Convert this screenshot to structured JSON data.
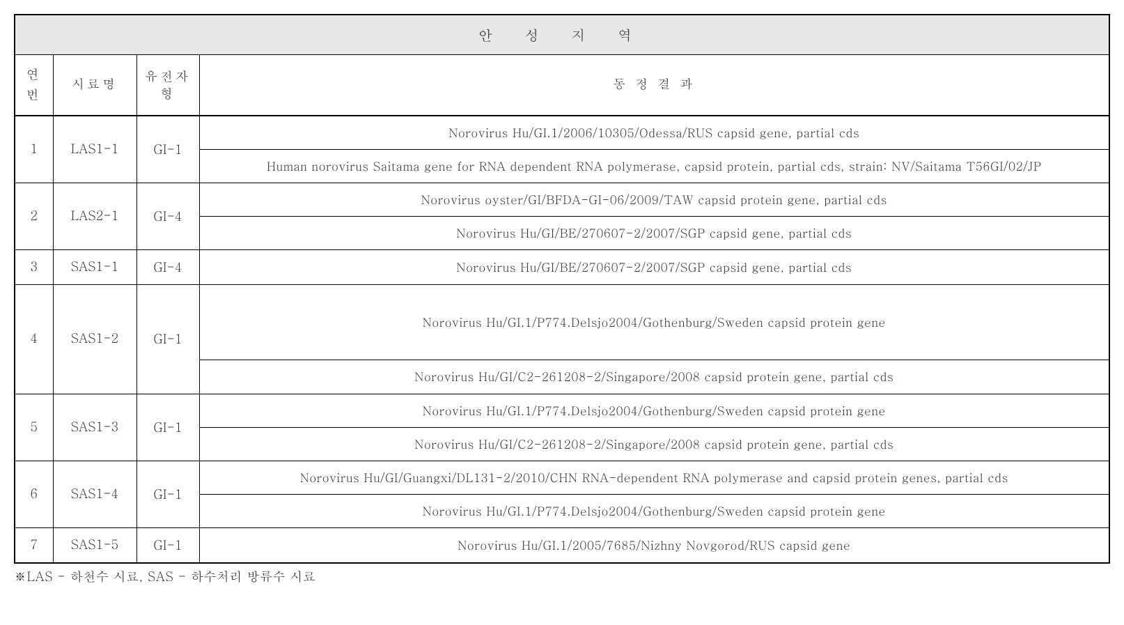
{
  "title": "안 성   지 역",
  "headers": {
    "num": "연번",
    "sample": "시료명",
    "type": "유전자형",
    "result": "동 정 결 과"
  },
  "rows": [
    {
      "num": "1",
      "sample": "LAS1-1",
      "type": "GI-1",
      "results": [
        "Norovirus   Hu/GI.1/2006/10305/Odessa/RUS capsid gene, partial cds",
        "Human   norovirus Saitama gene for RNA dependent RNA polymerase, capsid protein,   partial cds, strain: NV/Saitama T56GI/02/JP"
      ]
    },
    {
      "num": "2",
      "sample": "LAS2-1",
      "type": "GI-4",
      "results": [
        "Norovirus   oyster/GI/BFDA-GI-06/2009/TAW capsid protein gene, partial cds",
        "Norovirus   Hu/GI/BE/270607-2/2007/SGP capsid gene, partial cds"
      ]
    },
    {
      "num": "3",
      "sample": "SAS1-1",
      "type": "GI-4",
      "results": [
        "Norovirus   Hu/GI/BE/270607-2/2007/SGP capsid gene, partial cds"
      ]
    },
    {
      "num": "4",
      "sample": "SAS1-2",
      "type": "GI-1",
      "results": [
        "Norovirus   Hu/GI.1/P774.Delsjo2004/Gothenburg/Sweden capsid protein gene",
        "Norovirus   Hu/GI/C2-261208-2/Singapore/2008 capsid protein gene, partial cds"
      ],
      "tall": true
    },
    {
      "num": "5",
      "sample": "SAS1-3",
      "type": "GI-1",
      "results": [
        "Norovirus   Hu/GI.1/P774.Delsjo2004/Gothenburg/Sweden capsid protein gene",
        "Norovirus   Hu/GI/C2-261208-2/Singapore/2008 capsid protein gene, partial cds"
      ]
    },
    {
      "num": "6",
      "sample": "SAS1-4",
      "type": "GI-1",
      "results": [
        "Norovirus   Hu/GI/Guangxi/DL131-2/2010/CHN RNA-dependent RNA polymerase and capsid   protein genes, partial cds",
        "Norovirus   Hu/GI.1/P774.Delsjo2004/Gothenburg/Sweden capsid protein gene"
      ]
    },
    {
      "num": "7",
      "sample": "SAS1-5",
      "type": "GI-1",
      "results": [
        "Norovirus   Hu/GI.1/2005/7685/Nizhny Novgorod/RUS capsid gene"
      ]
    }
  ],
  "footnote": "※LAS - 하천수 시료, SAS - 하수처리 방류수 시료"
}
